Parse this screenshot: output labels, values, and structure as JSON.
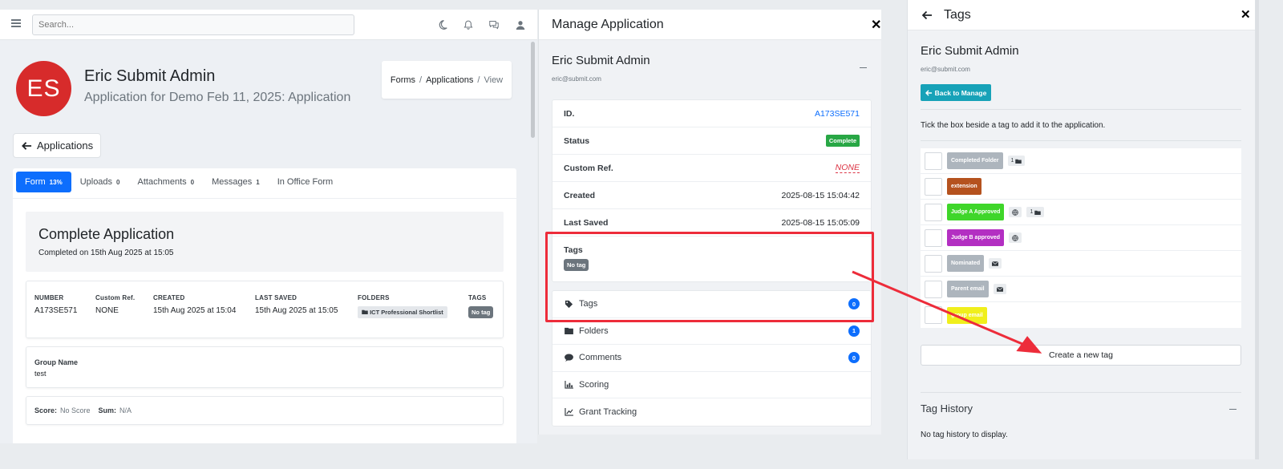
{
  "app": {
    "search_placeholder": "Search...",
    "icons": [
      "hamburger-icon",
      "moon-icon",
      "bell-icon",
      "chat-icon",
      "user-icon"
    ]
  },
  "profile": {
    "initials": "ES",
    "avatar_color": "#d72b2b",
    "name": "Eric Submit Admin",
    "subtitle": "Application for Demo Feb 11, 2025: Application"
  },
  "breadcrumb": {
    "items": [
      "Forms",
      "Applications",
      "View"
    ],
    "separator": "/"
  },
  "back_button": {
    "label": "Applications"
  },
  "tabs": [
    {
      "label": "Form",
      "count": "13%",
      "active": true
    },
    {
      "label": "Uploads",
      "count": "0"
    },
    {
      "label": "Attachments",
      "count": "0"
    },
    {
      "label": "Messages",
      "count": "1"
    },
    {
      "label": "In Office Form",
      "count": ""
    }
  ],
  "complete": {
    "title": "Complete Application",
    "subtitle": "Completed on 15th Aug 2025 at 15:05"
  },
  "meta": {
    "number_h": "NUMBER",
    "number_v": "A173SE571",
    "customref_h": "Custom Ref.",
    "customref_v": "NONE",
    "created_h": "CREATED",
    "created_v": "15th Aug 2025 at 15:04",
    "lastsaved_h": "LAST SAVED",
    "lastsaved_v": "15th Aug 2025 at 15:05",
    "folders_h": "FOLDERS",
    "folder_v": "ICT Professional Shortlist",
    "tags_h": "TAGS",
    "tags_v": "No tag"
  },
  "group": {
    "label": "Group Name",
    "value": "test"
  },
  "score": {
    "score_label": "Score:",
    "score_value": "No Score",
    "sum_label": "Sum:",
    "sum_value": "N/A"
  },
  "manage": {
    "title": "Manage Application",
    "name": "Eric Submit Admin",
    "email": "eric@submit.com",
    "rows": {
      "id_label": "ID.",
      "id_value": "A173SE571",
      "status_label": "Status",
      "status_value": "Complete",
      "customref_label": "Custom Ref.",
      "customref_value": "NONE",
      "created_label": "Created",
      "created_value": "2025-08-15 15:04:42",
      "lastsaved_label": "Last Saved",
      "lastsaved_value": "2025-08-15 15:05:09",
      "tags_label": "Tags",
      "tags_value": "No tag"
    },
    "menu": [
      {
        "label": "Tags",
        "count": "0",
        "icon": "tag-icon"
      },
      {
        "label": "Folders",
        "count": "1",
        "icon": "folder-icon"
      },
      {
        "label": "Comments",
        "count": "0",
        "icon": "comment-icon"
      },
      {
        "label": "Scoring",
        "count": "",
        "icon": "chart-bar-icon"
      },
      {
        "label": "Grant Tracking",
        "count": "",
        "icon": "chart-line-icon"
      }
    ]
  },
  "tags_panel": {
    "title": "Tags",
    "name": "Eric Submit Admin",
    "email": "eric@submit.com",
    "back_label": "Back to Manage",
    "instruction": "Tick the box beside a tag to add it to the application.",
    "tags": [
      {
        "label": "Completed Folder",
        "color": "#adb5bd",
        "chips": [
          {
            "text": "1",
            "icon": "folder-icon"
          }
        ]
      },
      {
        "label": "extension",
        "color": "#b5521e",
        "chips": []
      },
      {
        "label": "Judge A Approved",
        "color": "#3fd62a",
        "chips": [
          {
            "text": "",
            "icon": "globe-icon"
          },
          {
            "text": "1",
            "icon": "folder-icon"
          }
        ]
      },
      {
        "label": "Judge B approved",
        "color": "#b32fc2",
        "chips": [
          {
            "text": "",
            "icon": "globe-icon"
          }
        ]
      },
      {
        "label": "Nominated",
        "color": "#adb5bd",
        "chips": [
          {
            "text": "",
            "icon": "envelope-icon"
          }
        ]
      },
      {
        "label": "Parent email",
        "color": "#adb5bd",
        "chips": [
          {
            "text": "",
            "icon": "envelope-icon"
          }
        ]
      },
      {
        "label": "group email",
        "color": "#f0ef1c",
        "chips": []
      }
    ],
    "create_label": "Create a new tag",
    "history_title": "Tag History",
    "history_empty": "No tag history to display."
  },
  "annotation": {
    "color": "#ed2c3a"
  }
}
